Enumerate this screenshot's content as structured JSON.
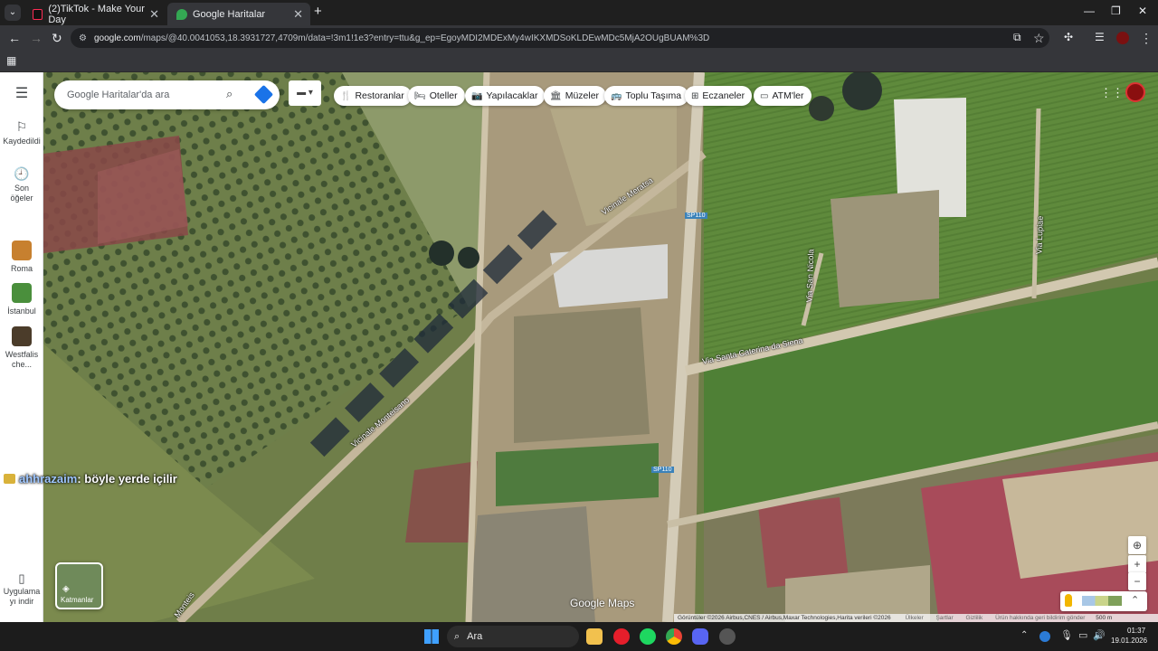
{
  "browser": {
    "tabs": [
      {
        "title": "(2)TikTok - Make Your Day",
        "active": false
      },
      {
        "title": "Google Haritalar",
        "active": true
      }
    ],
    "url_host": "google.com",
    "url_rest": "/maps/@40.0041053,18.3931727,4709m/data=!3m1!1e3?entry=ttu&g_ep=EgoyMDI2MDExMy4wIKXMDSoKLDEwMDc5MjA2OUgBUAM%3D",
    "new_tab": "+",
    "minimize": "—",
    "restore": "❐",
    "close": "✕"
  },
  "maps": {
    "search_placeholder": "Google Haritalar'da ara",
    "chips": [
      {
        "icon": "restaurant-icon",
        "glyph": "🍴",
        "label": "Restoranlar"
      },
      {
        "icon": "hotel-icon",
        "glyph": "🛏",
        "label": "Oteller"
      },
      {
        "icon": "camera-icon",
        "glyph": "📷",
        "label": "Yapılacaklar"
      },
      {
        "icon": "museum-icon",
        "glyph": "🏛",
        "label": "Müzeler"
      },
      {
        "icon": "transit-icon",
        "glyph": "🚌",
        "label": "Toplu Taşıma"
      },
      {
        "icon": "pharmacy-icon",
        "glyph": "⊞",
        "label": "Eczaneler"
      },
      {
        "icon": "atm-icon",
        "glyph": "▭",
        "label": "ATM'ler"
      }
    ],
    "sidebar": {
      "saved": "Kaydedildi",
      "recent_line1": "Son",
      "recent_line2": "öğeler",
      "places": [
        {
          "label": "Roma",
          "color": "#c7802f"
        },
        {
          "label": "İstanbul",
          "color": "#4a8f3c"
        },
        {
          "label_line1": "Westfalis",
          "label_line2": "che...",
          "color": "#4b3c2a"
        }
      ],
      "app_line1": "Uygulama",
      "app_line2": "yı indir"
    },
    "layers_label": "Katmanlar",
    "watermark": "Google Maps",
    "attribution": "Görüntüler ©2026 Airbus,CNES / Airbus,Maxar Technologies,Harita verileri ©2026",
    "footer_links": [
      "Ülkeler",
      "Şartlar",
      "Gizlilik",
      "Ürün hakkında geri bildirim gönder"
    ],
    "scale": "500 m",
    "roads": [
      {
        "name": "Vicinale Meratsa",
        "rot": -34
      },
      {
        "name": "SP110",
        "rot": 0
      },
      {
        "name": "Via Santa Caterina da Siena",
        "rot": -12
      },
      {
        "name": "Vicinale Monteisano",
        "rot": -40
      },
      {
        "name": "SP110",
        "rot": 0
      },
      {
        "name": "Via San Nicola",
        "rot": -88
      },
      {
        "name": "Via Lupiae",
        "rot": -88
      },
      {
        "name": "Monteis",
        "rot": -55
      }
    ]
  },
  "chat": {
    "user": "ahhrazaim",
    "message": ": böyle yerde içilir"
  },
  "taskbar": {
    "search": "Ara",
    "time": "01:37",
    "date": "19.01.2026"
  }
}
